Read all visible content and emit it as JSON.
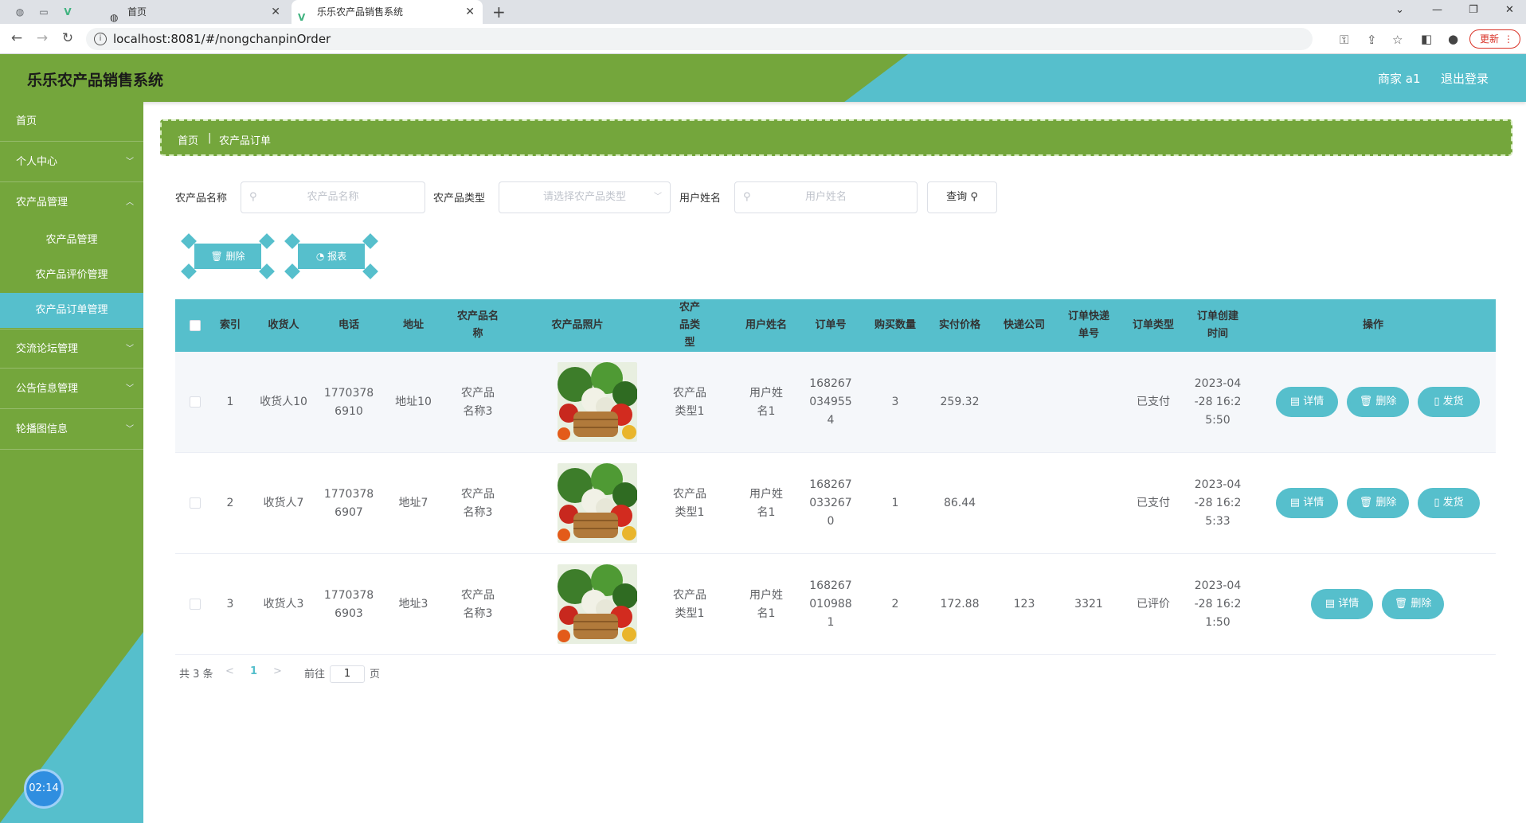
{
  "browser": {
    "tab_home": "首页",
    "tab_active": "乐乐农产品销售系统",
    "url": "localhost:8081/#/nongchanpinOrder",
    "update_label": "更新"
  },
  "header": {
    "title": "乐乐农产品销售系统",
    "user": "商家 a1",
    "logout": "退出登录"
  },
  "sidebar": {
    "items": [
      {
        "label": "首页"
      },
      {
        "label": "个人中心"
      },
      {
        "label": "农产品管理"
      },
      {
        "label": "交流论坛管理"
      },
      {
        "label": "公告信息管理"
      },
      {
        "label": "轮播图信息"
      }
    ],
    "subitems": [
      {
        "label": "农产品管理"
      },
      {
        "label": "农产品评价管理"
      },
      {
        "label": "农产品订单管理"
      }
    ],
    "timer": "02:14"
  },
  "breadcrumb": {
    "home": "首页",
    "sep": "|",
    "current": "农产品订单"
  },
  "filters": {
    "name_label": "农产品名称",
    "name_placeholder": "农产品名称",
    "type_label": "农产品类型",
    "type_placeholder": "请选择农产品类型",
    "user_label": "用户姓名",
    "user_placeholder": "用户姓名",
    "query_label": "查询"
  },
  "actions": {
    "delete_label": "删除",
    "report_label": "报表"
  },
  "table": {
    "columns": [
      "索引",
      "收货人",
      "电话",
      "地址",
      "农产品名称",
      "农产品照片",
      "农产品类型",
      "用户姓名",
      "订单号",
      "购买数量",
      "实付价格",
      "快递公司",
      "订单快递单号",
      "订单类型",
      "订单创建时间",
      "操作"
    ],
    "rows": [
      {
        "index": "1",
        "receiver": "收货人10",
        "phone": "17703786910",
        "address": "地址10",
        "product": "农产品名称3",
        "type": "农产品类型1",
        "user": "用户姓名1",
        "order_no": "1682670349554",
        "qty": "3",
        "price": "259.32",
        "courier": "",
        "tracking": "",
        "status": "已支付",
        "created": "2023-04-28 16:25:50",
        "ops": [
          "详情",
          "删除",
          "发货"
        ]
      },
      {
        "index": "2",
        "receiver": "收货人7",
        "phone": "17703786907",
        "address": "地址7",
        "product": "农产品名称3",
        "type": "农产品类型1",
        "user": "用户姓名1",
        "order_no": "1682670332670",
        "qty": "1",
        "price": "86.44",
        "courier": "",
        "tracking": "",
        "status": "已支付",
        "created": "2023-04-28 16:25:33",
        "ops": [
          "详情",
          "删除",
          "发货"
        ]
      },
      {
        "index": "3",
        "receiver": "收货人3",
        "phone": "17703786903",
        "address": "地址3",
        "product": "农产品名称3",
        "type": "农产品类型1",
        "user": "用户姓名1",
        "order_no": "1682670109881",
        "qty": "2",
        "price": "172.88",
        "courier": "123",
        "tracking": "3321",
        "status": "已评价",
        "created": "2023-04-28 16:21:50",
        "ops": [
          "详情",
          "删除"
        ]
      }
    ]
  },
  "pagination": {
    "total": "共 3 条",
    "prev": "<",
    "page": "1",
    "next": ">",
    "goto_label": "前往",
    "goto_value": "1",
    "page_unit": "页"
  },
  "colors": {
    "green": "#74a63c",
    "teal": "#56bfcc"
  }
}
